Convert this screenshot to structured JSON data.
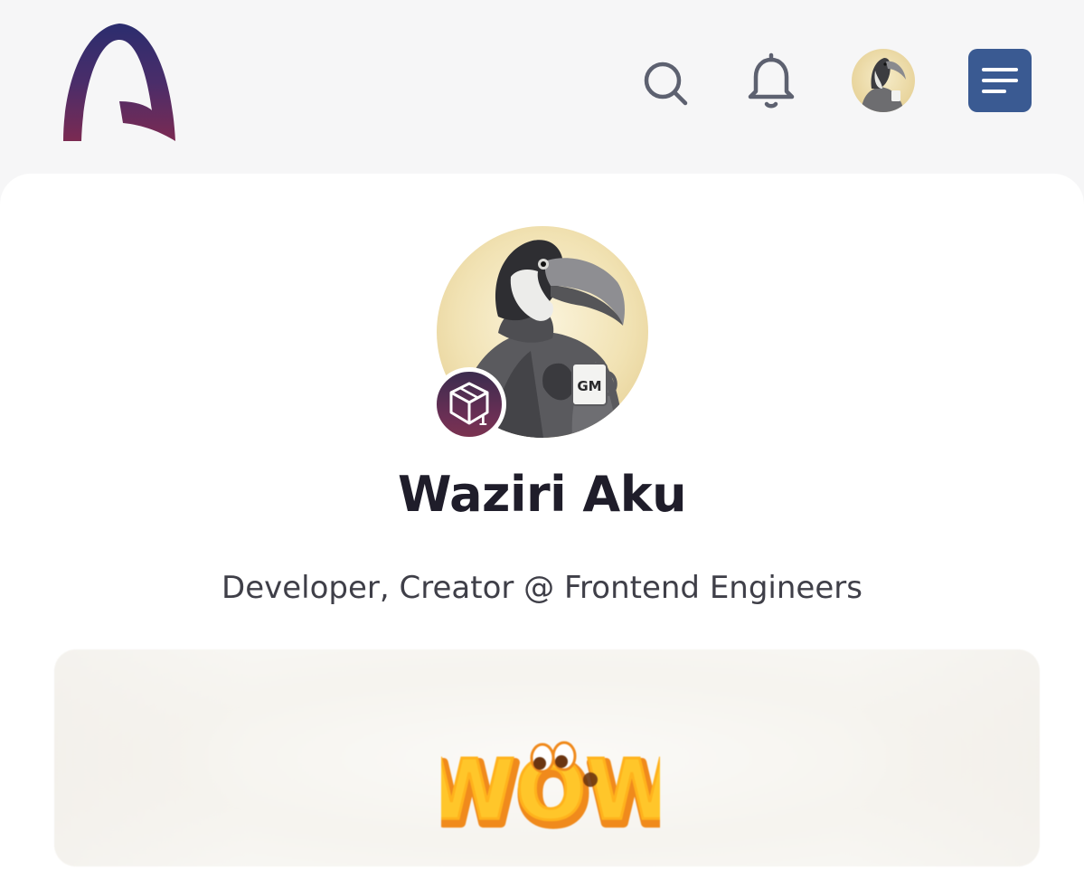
{
  "header": {
    "logo_icon": "app-logo-arch",
    "search_icon": "search-icon",
    "bell_icon": "bell-icon",
    "avatar_icon": "toucan-avatar",
    "menu_icon": "menu-icon"
  },
  "profile": {
    "name": "Waziri Aku",
    "bio": "Developer, Creator @ Frontend Engineers",
    "badge_count": "1",
    "mug_text": "GM"
  },
  "media": {
    "sticker_text": "WOW"
  },
  "colors": {
    "menu_button": "#3a5a92",
    "logo_top": "#2b2d6e",
    "logo_bottom": "#7b2a52",
    "badge_bg": "#5a2d55",
    "name_text": "#1f1d2a",
    "bio_text": "#3f3f48",
    "sticker_fill": "#ffb81c",
    "sticker_outline": "#f08a1c"
  }
}
